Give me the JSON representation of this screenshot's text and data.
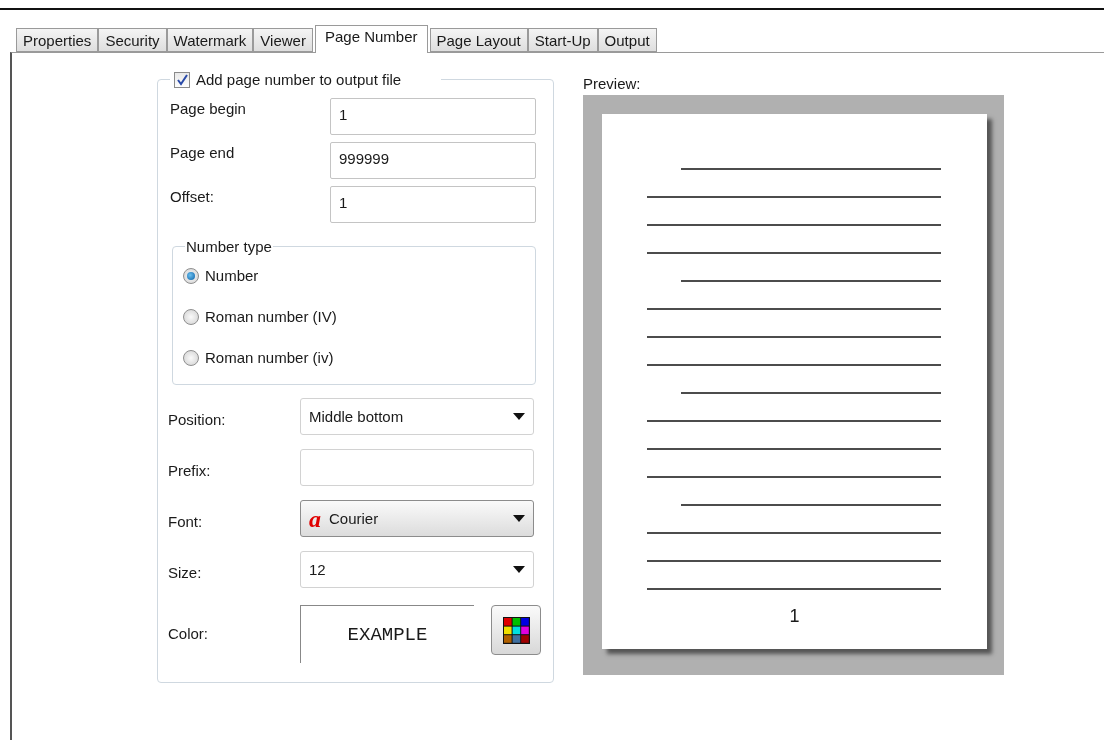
{
  "tabs": [
    {
      "label": "Properties",
      "selected": false
    },
    {
      "label": "Security",
      "selected": false
    },
    {
      "label": "Watermark",
      "selected": false
    },
    {
      "label": "Viewer",
      "selected": false
    },
    {
      "label": "Page Number",
      "selected": true
    },
    {
      "label": "Page Layout",
      "selected": false
    },
    {
      "label": "Start-Up",
      "selected": false
    },
    {
      "label": "Output",
      "selected": false
    }
  ],
  "page_number": {
    "enable": {
      "label": "Add page number to output file",
      "checked": true
    },
    "fields": [
      {
        "label": "Page begin",
        "value": "1"
      },
      {
        "label": "Page end",
        "value": "999999"
      },
      {
        "label": "Offset:",
        "value": "1"
      }
    ],
    "number_type": {
      "title": "Number type",
      "options": [
        {
          "label": "Number",
          "selected": true
        },
        {
          "label": "Roman number (IV)",
          "selected": false
        },
        {
          "label": "Roman number (iv)",
          "selected": false
        }
      ]
    },
    "settings": [
      {
        "kind": "dropdown",
        "label": "Position:",
        "value": "Middle bottom"
      },
      {
        "kind": "text",
        "label": "Prefix:"
      },
      {
        "kind": "font",
        "label": "Font:",
        "icon": "a",
        "value": "Courier"
      },
      {
        "kind": "dropdown",
        "label": "Size:",
        "value": "12"
      },
      {
        "kind": "color",
        "label": "Color:",
        "value": "EXAMPLE"
      }
    ]
  },
  "preview": {
    "label": "Preview:",
    "page_number": "1"
  }
}
